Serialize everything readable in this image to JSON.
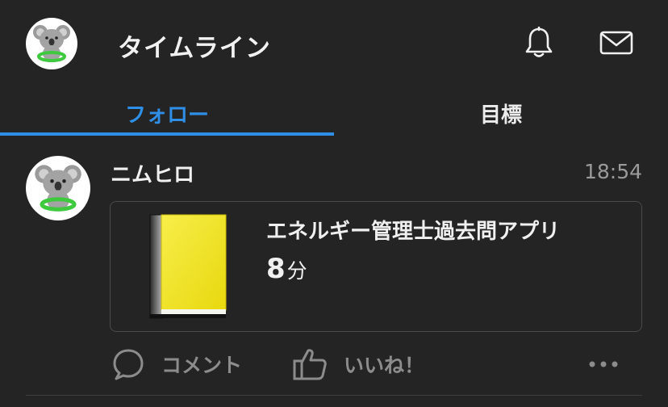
{
  "header": {
    "title": "タイムライン",
    "avatar_icon": "koala-avatar-icon",
    "bell_icon": "bell-icon",
    "mail_icon": "mail-icon"
  },
  "tabs": [
    {
      "label": "フォロー",
      "active": true
    },
    {
      "label": "目標",
      "active": false
    }
  ],
  "post": {
    "username": "ニムヒロ",
    "time": "18:54",
    "card": {
      "title": "エネルギー管理士過去問アプリ",
      "duration_value": "8",
      "duration_unit": "分",
      "book_icon": "yellow-book-icon"
    },
    "actions": {
      "comment_label": "コメント",
      "like_label": "いいね！",
      "more_icon": "more-dots-icon"
    }
  },
  "colors": {
    "background": "#242424",
    "accent": "#2f8fe6",
    "muted": "#8c8c8c",
    "book_yellow": "#f2e41e"
  }
}
